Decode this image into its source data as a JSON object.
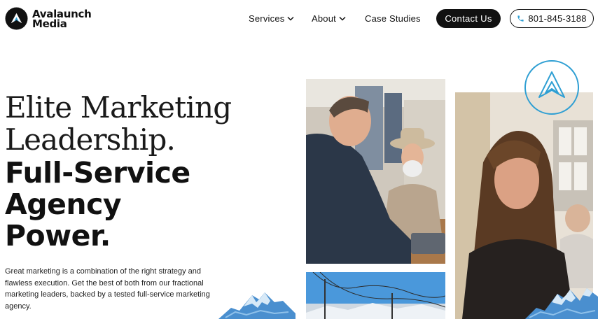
{
  "brand": {
    "line1": "Avalaunch",
    "line2": "Media",
    "logo_icon": "mountain-peak-logo-icon",
    "color_dark": "#111111",
    "color_accent": "#2f9fd3"
  },
  "nav": {
    "services_label": "Services",
    "about_label": "About",
    "case_studies_label": "Case Studies",
    "contact_label": "Contact Us",
    "phone_label": "801-845-3188",
    "dropdown_icon": "chevron-down-icon",
    "phone_icon": "phone-icon"
  },
  "hero": {
    "serif_line1": "Elite Marketing",
    "serif_line2": "Leadership.",
    "bold_line1": "Full-Service",
    "bold_line2": "Agency",
    "bold_line3": "Power.",
    "intro": "Great marketing is a combination of the right strategy and flawless execution. Get the best of both from our fractional marketing leaders, backed by a tested full-service marketing agency."
  }
}
